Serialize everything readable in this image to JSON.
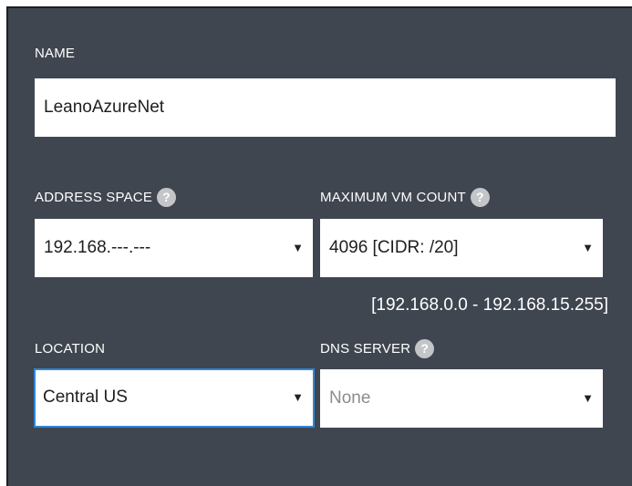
{
  "form": {
    "name": {
      "label": "NAME",
      "value": "LeanoAzureNet"
    },
    "address_space": {
      "label": "ADDRESS SPACE",
      "help_icon": "?",
      "value": "192.168.---.---"
    },
    "max_vm_count": {
      "label": "MAXIMUM VM COUNT",
      "help_icon": "?",
      "value": "4096 [CIDR: /20]"
    },
    "cidr_range": "[192.168.0.0 - 192.168.15.255]",
    "location": {
      "label": "LOCATION",
      "value": "Central US"
    },
    "dns_server": {
      "label": "DNS SERVER",
      "help_icon": "?",
      "value": "None"
    },
    "dropdown_arrow": "▼"
  },
  "colors": {
    "panel_bg": "#3f4650",
    "focus_border": "#2f86d8",
    "help_icon_bg": "#c3c5c8"
  }
}
